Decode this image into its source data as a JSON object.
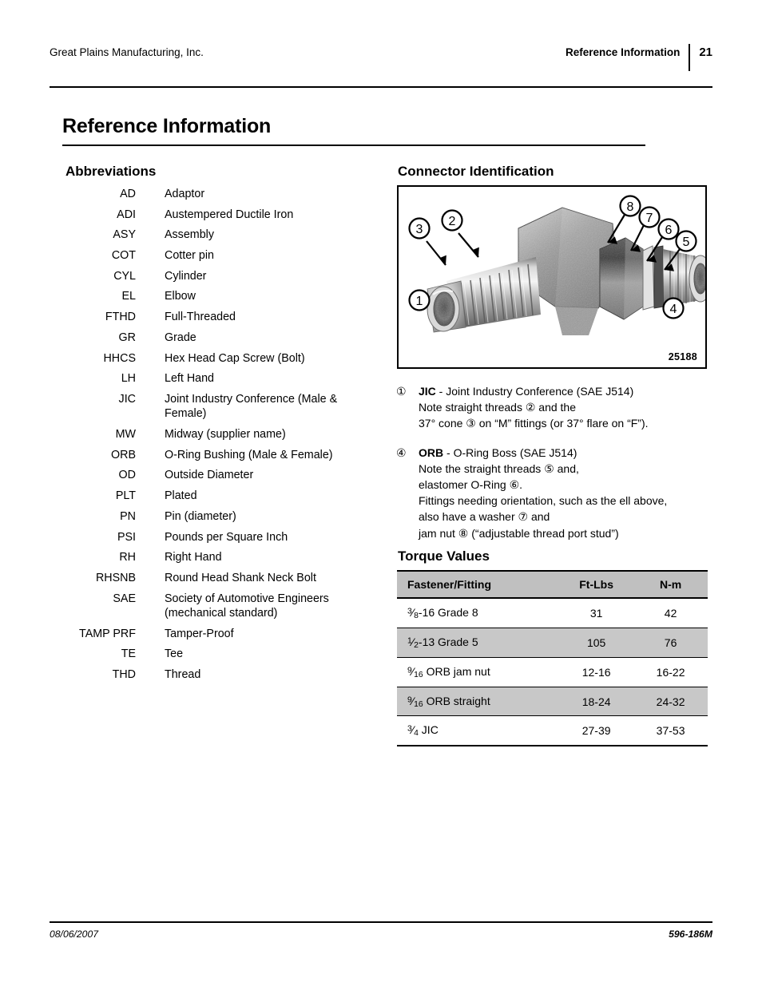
{
  "header": {
    "company": "Great Plains Manufacturing, Inc.",
    "section": "Reference Information",
    "page_number": "21"
  },
  "chapter_title": "Reference Information",
  "abbreviations": {
    "heading": "Abbreviations",
    "items": [
      {
        "term": "AD",
        "definition": "Adaptor"
      },
      {
        "term": "ADI",
        "definition": "Austempered Ductile Iron"
      },
      {
        "term": "ASY",
        "definition": "Assembly"
      },
      {
        "term": "COT",
        "definition": "Cotter pin"
      },
      {
        "term": "CYL",
        "definition": "Cylinder"
      },
      {
        "term": "EL",
        "definition": "Elbow"
      },
      {
        "term": "FTHD",
        "definition": "Full-Threaded"
      },
      {
        "term": "GR",
        "definition": "Grade"
      },
      {
        "term": "HHCS",
        "definition": "Hex Head Cap Screw (Bolt)"
      },
      {
        "term": "LH",
        "definition": "Left Hand"
      },
      {
        "term": "JIC",
        "definition": "Joint Industry Conference (Male & Female)"
      },
      {
        "term": "MW",
        "definition": "Midway (supplier name)"
      },
      {
        "term": "ORB",
        "definition": "O-Ring Bushing (Male & Female)"
      },
      {
        "term": "OD",
        "definition": "Outside Diameter"
      },
      {
        "term": "PLT",
        "definition": "Plated"
      },
      {
        "term": "PN",
        "definition": "Pin (diameter)"
      },
      {
        "term": "PSI",
        "definition": "Pounds per Square Inch"
      },
      {
        "term": "RH",
        "definition": "Right Hand"
      },
      {
        "term": "RHSNB",
        "definition": "Round Head Shank Neck Bolt"
      },
      {
        "term": "SAE",
        "definition": "Society of Automotive Engineers (mechanical standard)"
      },
      {
        "term": "TAMP PRF",
        "definition": "Tamper-Proof"
      },
      {
        "term": "TE",
        "definition": "Tee"
      },
      {
        "term": "THD",
        "definition": "Thread"
      }
    ]
  },
  "connector": {
    "heading": "Connector Identification",
    "figure_id": "25188",
    "figure_description": "90-degree hydraulic elbow fitting, JIC male flare end at left and O-Ring Boss straight-thread end at right, with eight numbered callouts.",
    "callouts": [
      "1",
      "2",
      "3",
      "4",
      "5",
      "6",
      "7",
      "8"
    ],
    "notes": [
      {
        "marker": "①",
        "lines": [
          "JIC - Joint Industry Conference (SAE J514)",
          "Note straight threads ② and the",
          "37° cone ③ on “M” fittings (or 37° flare on “F”)."
        ],
        "bold_lead": "JIC"
      },
      {
        "marker": "④",
        "lines": [
          "ORB - O-Ring Boss (SAE J514)",
          "Note the straight threads ⑤ and,",
          "elastomer O-Ring ⑥.",
          "Fittings needing orientation, such as the ell above,",
          "also have a washer ⑦ and",
          "jam nut ⑧ (“adjustable thread port stud”)"
        ],
        "bold_lead": "ORB"
      }
    ]
  },
  "torque": {
    "heading": "Torque Values",
    "columns": [
      "Fastener/Fitting",
      "Ft-Lbs",
      "N-m"
    ],
    "rows": [
      {
        "numerator": "3",
        "denominator": "8",
        "rest": "-16 Grade 8",
        "ftlbs": "31",
        "nm": "42",
        "shaded": false
      },
      {
        "numerator": "1",
        "denominator": "2",
        "rest": "-13 Grade 5",
        "ftlbs": "105",
        "nm": "76",
        "shaded": true
      },
      {
        "numerator": "9",
        "denominator": "16",
        "rest": " ORB jam nut",
        "ftlbs": "12-16",
        "nm": "16-22",
        "shaded": false
      },
      {
        "numerator": "9",
        "denominator": "16",
        "rest": " ORB straight",
        "ftlbs": "18-24",
        "nm": "24-32",
        "shaded": true
      },
      {
        "numerator": "3",
        "denominator": "4",
        "rest": " JIC",
        "ftlbs": "27-39",
        "nm": "37-53",
        "shaded": false
      }
    ]
  },
  "footer": {
    "date": "08/06/2007",
    "document_number": "596-186M"
  },
  "colors": {
    "header_shade": "#c0c0c0",
    "row_shade": "#c8c8c8",
    "rule": "#000000"
  }
}
